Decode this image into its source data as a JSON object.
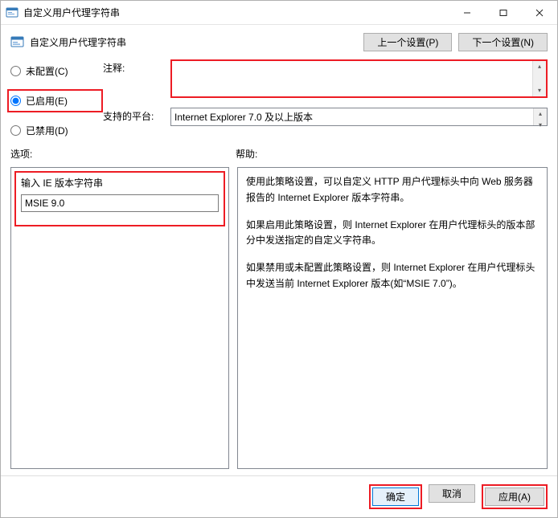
{
  "window": {
    "title": "自定义用户代理字符串"
  },
  "header": {
    "label": "自定义用户代理字符串",
    "prev_setting": "上一个设置(P)",
    "next_setting": "下一个设置(N)"
  },
  "radios": {
    "not_configured": "未配置(C)",
    "enabled": "已启用(E)",
    "disabled": "已禁用(D)",
    "selected": "enabled"
  },
  "fields": {
    "comment_label": "注释:",
    "comment_value": "",
    "platform_label": "支持的平台:",
    "platform_value": "Internet Explorer 7.0 及以上版本"
  },
  "sections": {
    "options_label": "选项:",
    "help_label": "帮助:"
  },
  "options": {
    "ie_version_label": "输入 IE 版本字符串",
    "ie_version_value": "MSIE 9.0"
  },
  "help": {
    "p1": "使用此策略设置，可以自定义 HTTP 用户代理标头中向 Web 服务器报告的 Internet Explorer 版本字符串。",
    "p2": "如果启用此策略设置，则 Internet Explorer 在用户代理标头的版本部分中发送指定的自定义字符串。",
    "p3": "如果禁用或未配置此策略设置，则 Internet Explorer 在用户代理标头中发送当前 Internet Explorer 版本(如“MSIE 7.0”)。"
  },
  "footer": {
    "ok": "确定",
    "cancel": "取消",
    "apply": "应用(A)"
  }
}
